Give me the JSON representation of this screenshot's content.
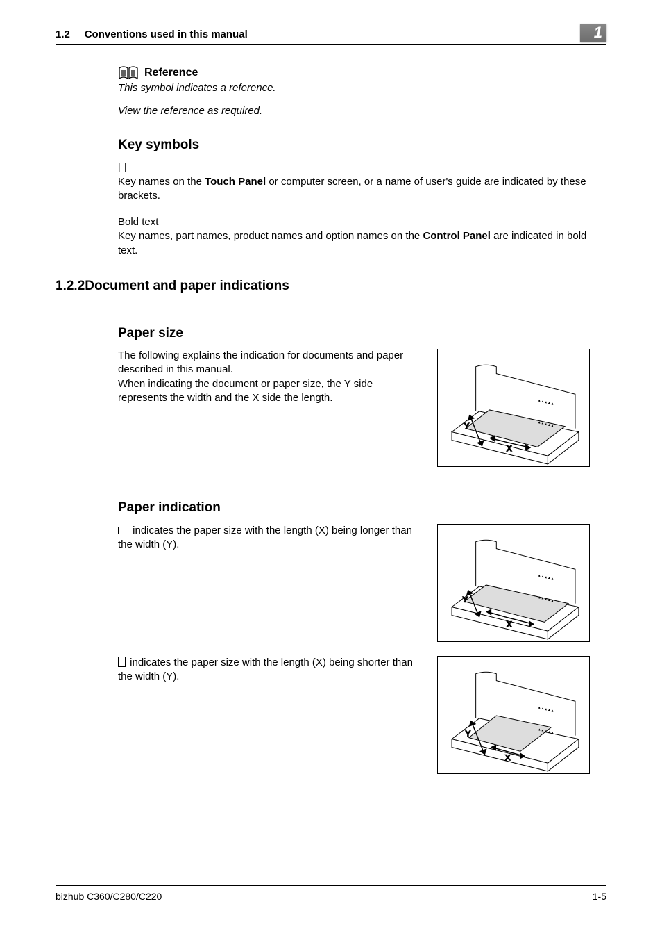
{
  "header": {
    "section_number": "1.2",
    "section_title": "Conventions used in this manual",
    "chapter_number": "1"
  },
  "reference_block": {
    "title": "Reference",
    "line1": "This symbol indicates a reference.",
    "line2": "View the reference as required."
  },
  "key_symbols": {
    "heading": "Key symbols",
    "bracket_label": "[ ]",
    "bracket_text_pre": "Key names on the ",
    "bracket_text_bold1": "Touch Panel",
    "bracket_text_post": " or computer screen, or a name of user's guide are indicated by these brackets.",
    "bold_label": "Bold text",
    "bold_text_pre": "Key names, part names, product names and option names on the ",
    "bold_text_bold1": "Control Panel",
    "bold_text_post": " are indicated in bold text."
  },
  "section_1_2_2": {
    "number": "1.2.2",
    "title": "Document and paper indications"
  },
  "paper_size": {
    "heading": "Paper size",
    "para1": "The following explains the indication for documents and paper described in this manual.",
    "para2": "When indicating the document or paper size, the Y side represents the width and the X side the length."
  },
  "paper_indication": {
    "heading": "Paper indication",
    "landscape_text": " indicates the paper size with the length (X) being longer than the width (Y).",
    "portrait_text": " indicates the paper size with the length (X) being shorter than the width (Y)."
  },
  "footer": {
    "model": "bizhub C360/C280/C220",
    "page_number": "1-5"
  }
}
